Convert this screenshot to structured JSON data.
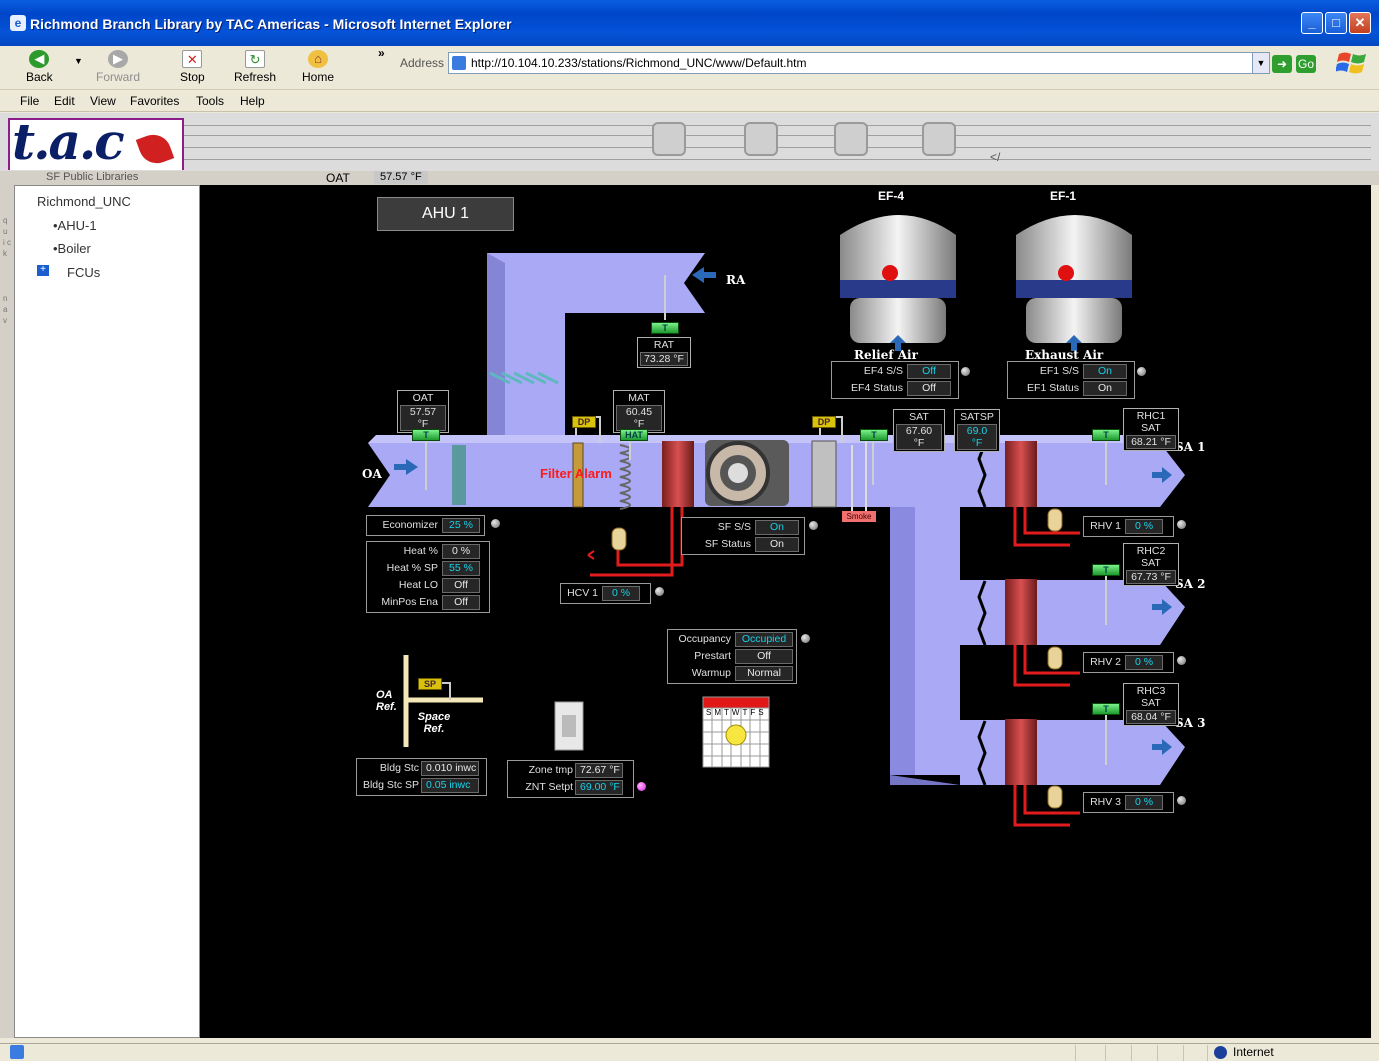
{
  "window": {
    "title": "Richmond Branch Library by TAC Americas - Microsoft Internet Explorer"
  },
  "toolbar": {
    "back": "Back",
    "forward": "Forward",
    "stop": "Stop",
    "refresh": "Refresh",
    "home": "Home",
    "chevron": "»"
  },
  "address": {
    "label": "Address",
    "url": "http://10.104.10.233/stations/Richmond_UNC/www/Default.htm",
    "go": "Go"
  },
  "menu": [
    "File",
    "Edit",
    "View",
    "Favorites",
    "Tools",
    "Help"
  ],
  "tac": {
    "logo": "t.a.c",
    "breadcrumb": "SF Public Libraries",
    "oat_label": "OAT",
    "oat_value": "57.57 °F",
    "lt": "</"
  },
  "nav": {
    "root": "Richmond_UNC",
    "items": [
      "•AHU-1",
      "•Boiler"
    ],
    "folder": "FCUs",
    "strip_text_1": "q u i c k",
    "strip_text_2": "n a v"
  },
  "diagram": {
    "title": "AHU 1",
    "ef4": {
      "label": "EF-4",
      "caption": "Relief Air",
      "ss_label": "EF4 S/S",
      "ss": "Off",
      "status_label": "EF4 Status",
      "status": "Off"
    },
    "ef1": {
      "label": "EF-1",
      "caption": "Exhaust Air",
      "ss_label": "EF1 S/S",
      "ss": "On",
      "status_label": "EF1 Status",
      "status": "On"
    },
    "ra": "RA",
    "oa": "OA",
    "rat": {
      "label": "RAT",
      "value": "73.28 °F"
    },
    "oat": {
      "label": "OAT",
      "value": "57.57 °F"
    },
    "mat": {
      "label": "MAT",
      "value": "60.45 °F"
    },
    "sat": {
      "label": "SAT",
      "value": "67.60 °F"
    },
    "satsp": {
      "label": "SATSP",
      "value": "69.0 °F"
    },
    "rhc1": {
      "label": "RHC1 SAT",
      "value": "68.21 °F"
    },
    "rhc2": {
      "label": "RHC2 SAT",
      "value": "67.73 °F"
    },
    "rhc3": {
      "label": "RHC3 SAT",
      "value": "68.04 °F"
    },
    "sa1": "SA 1",
    "sa2": "SA 2",
    "sa3": "SA 3",
    "t_badge": "T",
    "hat_badge": "HAT",
    "dp_badge": "DP",
    "sp_badge": "SP",
    "filter_alarm": "Filter Alarm",
    "smoke": "Smoke",
    "economizer": {
      "label": "Economizer",
      "value": "25 %"
    },
    "heat": {
      "heat_label": "Heat %",
      "heat": "0 %",
      "heatsp_label": "Heat % SP",
      "heatsp": "55 %",
      "heatlo_label": "Heat LO",
      "heatlo": "Off",
      "minpos_label": "MinPos Ena",
      "minpos": "Off"
    },
    "sf": {
      "ss_label": "SF S/S",
      "ss": "On",
      "status_label": "SF Status",
      "status": "On"
    },
    "hcv1": {
      "label": "HCV 1",
      "value": "0 %"
    },
    "rhv1": {
      "label": "RHV 1",
      "value": "0 %"
    },
    "rhv2": {
      "label": "RHV 2",
      "value": "0 %"
    },
    "rhv3": {
      "label": "RHV 3",
      "value": "0 %"
    },
    "occ": {
      "occ_label": "Occupancy",
      "occ": "Occupied",
      "prestart_label": "Prestart",
      "prestart": "Off",
      "warmup_label": "Warmup",
      "warmup": "Normal"
    },
    "sched_days": "SMTWTFS",
    "oa_ref": "OA Ref.",
    "space_ref": "Space Ref.",
    "bldg": {
      "stc_label": "Bldg Stc",
      "stc": "0.010 inwc",
      "sp_label": "Bldg Stc SP",
      "sp": "0.05 inwc"
    },
    "zone": {
      "tmp_label": "Zone tmp",
      "tmp": "72.67 °F",
      "sp_label": "ZNT Setpt",
      "sp": "69.00 °F"
    }
  },
  "status": {
    "zone": "Internet"
  },
  "colors": {
    "duct": "#a9a9f5",
    "background": "#000000",
    "cyan": "#19d1e8",
    "alarm": "#ff1a1a"
  }
}
